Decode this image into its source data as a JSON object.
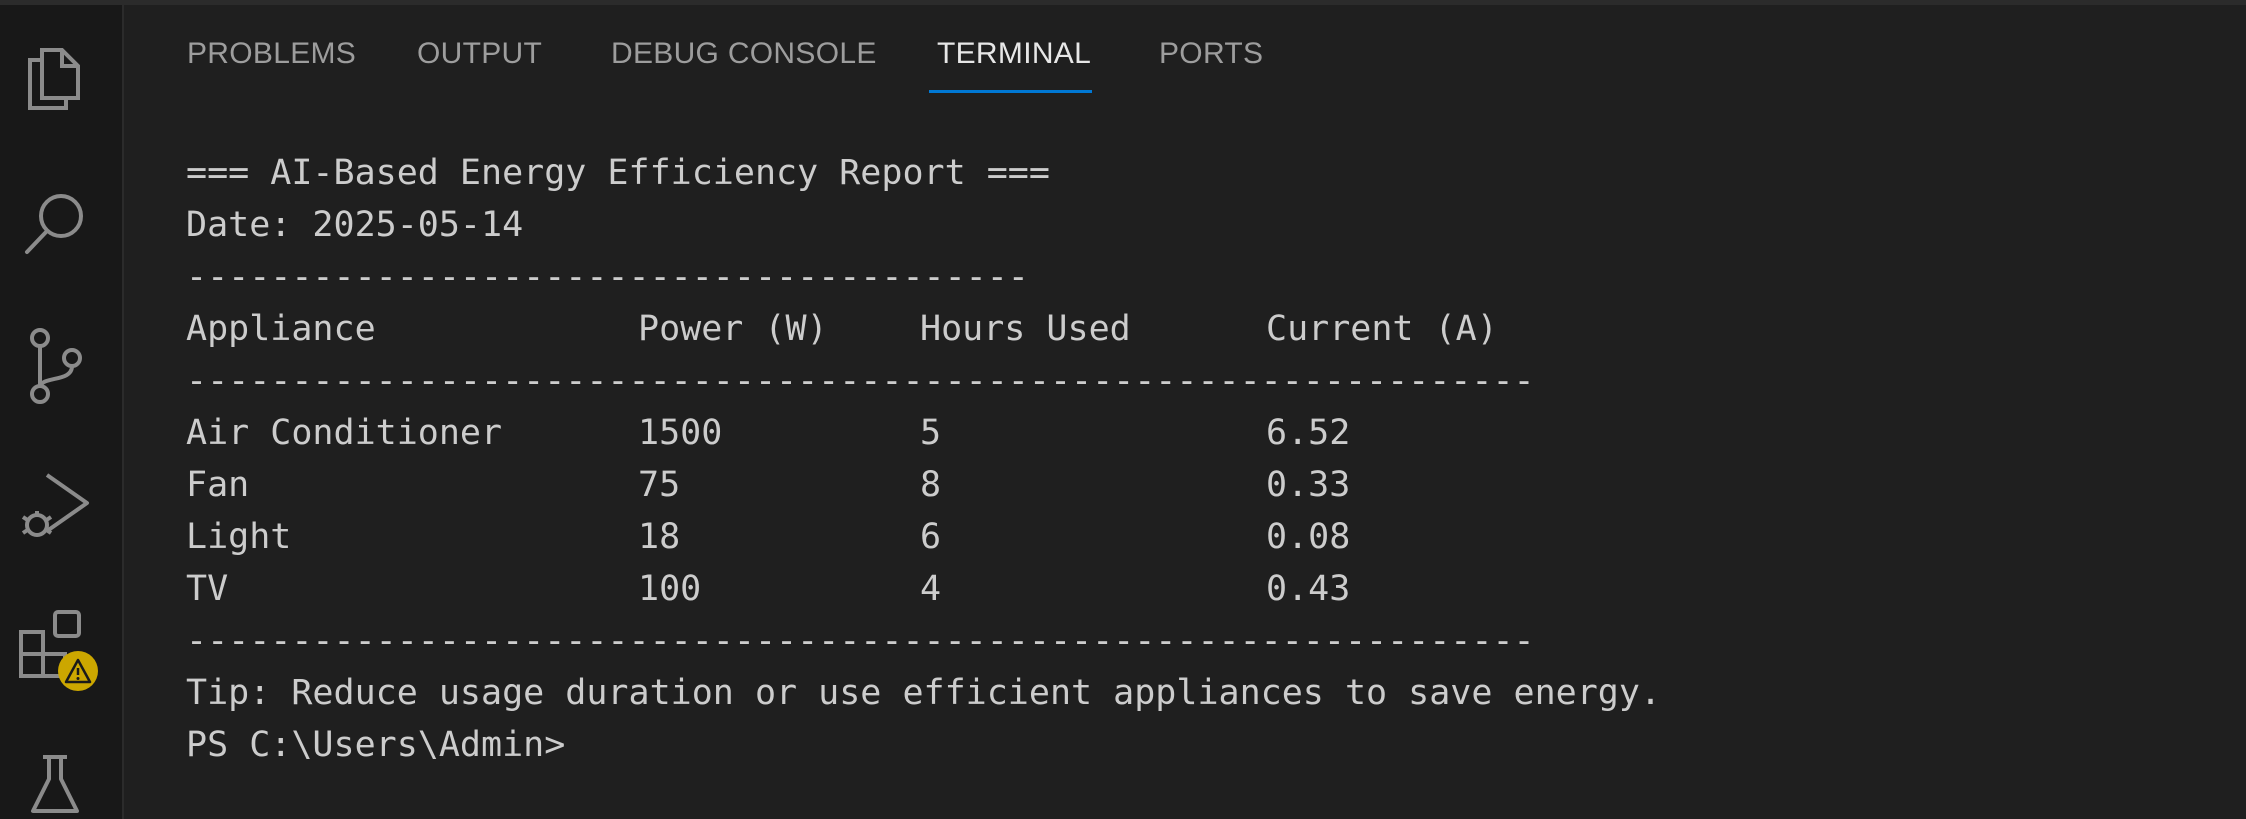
{
  "tabs": [
    {
      "label": "PROBLEMS",
      "active": false
    },
    {
      "label": "OUTPUT",
      "active": false
    },
    {
      "label": "DEBUG CONSOLE",
      "active": false
    },
    {
      "label": "TERMINAL",
      "active": true
    },
    {
      "label": "PORTS",
      "active": false
    }
  ],
  "activity_bar": {
    "icons": [
      "explorer-icon",
      "search-icon",
      "source-control-icon",
      "run-debug-icon",
      "extensions-icon",
      "testing-icon"
    ],
    "warning_badge": "⚠"
  },
  "terminal": {
    "title": "=== AI-Based Energy Efficiency Report ===",
    "date": "Date: 2025-05-14",
    "separator_short": "----------------------------------------",
    "separator_long": "----------------------------------------------------------------",
    "headers": [
      "Appliance",
      "Power (W)",
      "Hours Used",
      "Current (A)"
    ],
    "rows": [
      [
        "Air Conditioner",
        "1500",
        "5",
        "6.52"
      ],
      [
        "Fan",
        "75",
        "8",
        "0.33"
      ],
      [
        "Light",
        "18",
        "6",
        "0.08"
      ],
      [
        "TV",
        "100",
        "4",
        "0.43"
      ]
    ],
    "tip": "Tip: Reduce usage duration or use efficient appliances to save energy.",
    "prompt": "PS C:\\Users\\Admin>"
  },
  "colors": {
    "accent": "#0078d4",
    "warning": "#cca700",
    "text": "#cccccc"
  }
}
